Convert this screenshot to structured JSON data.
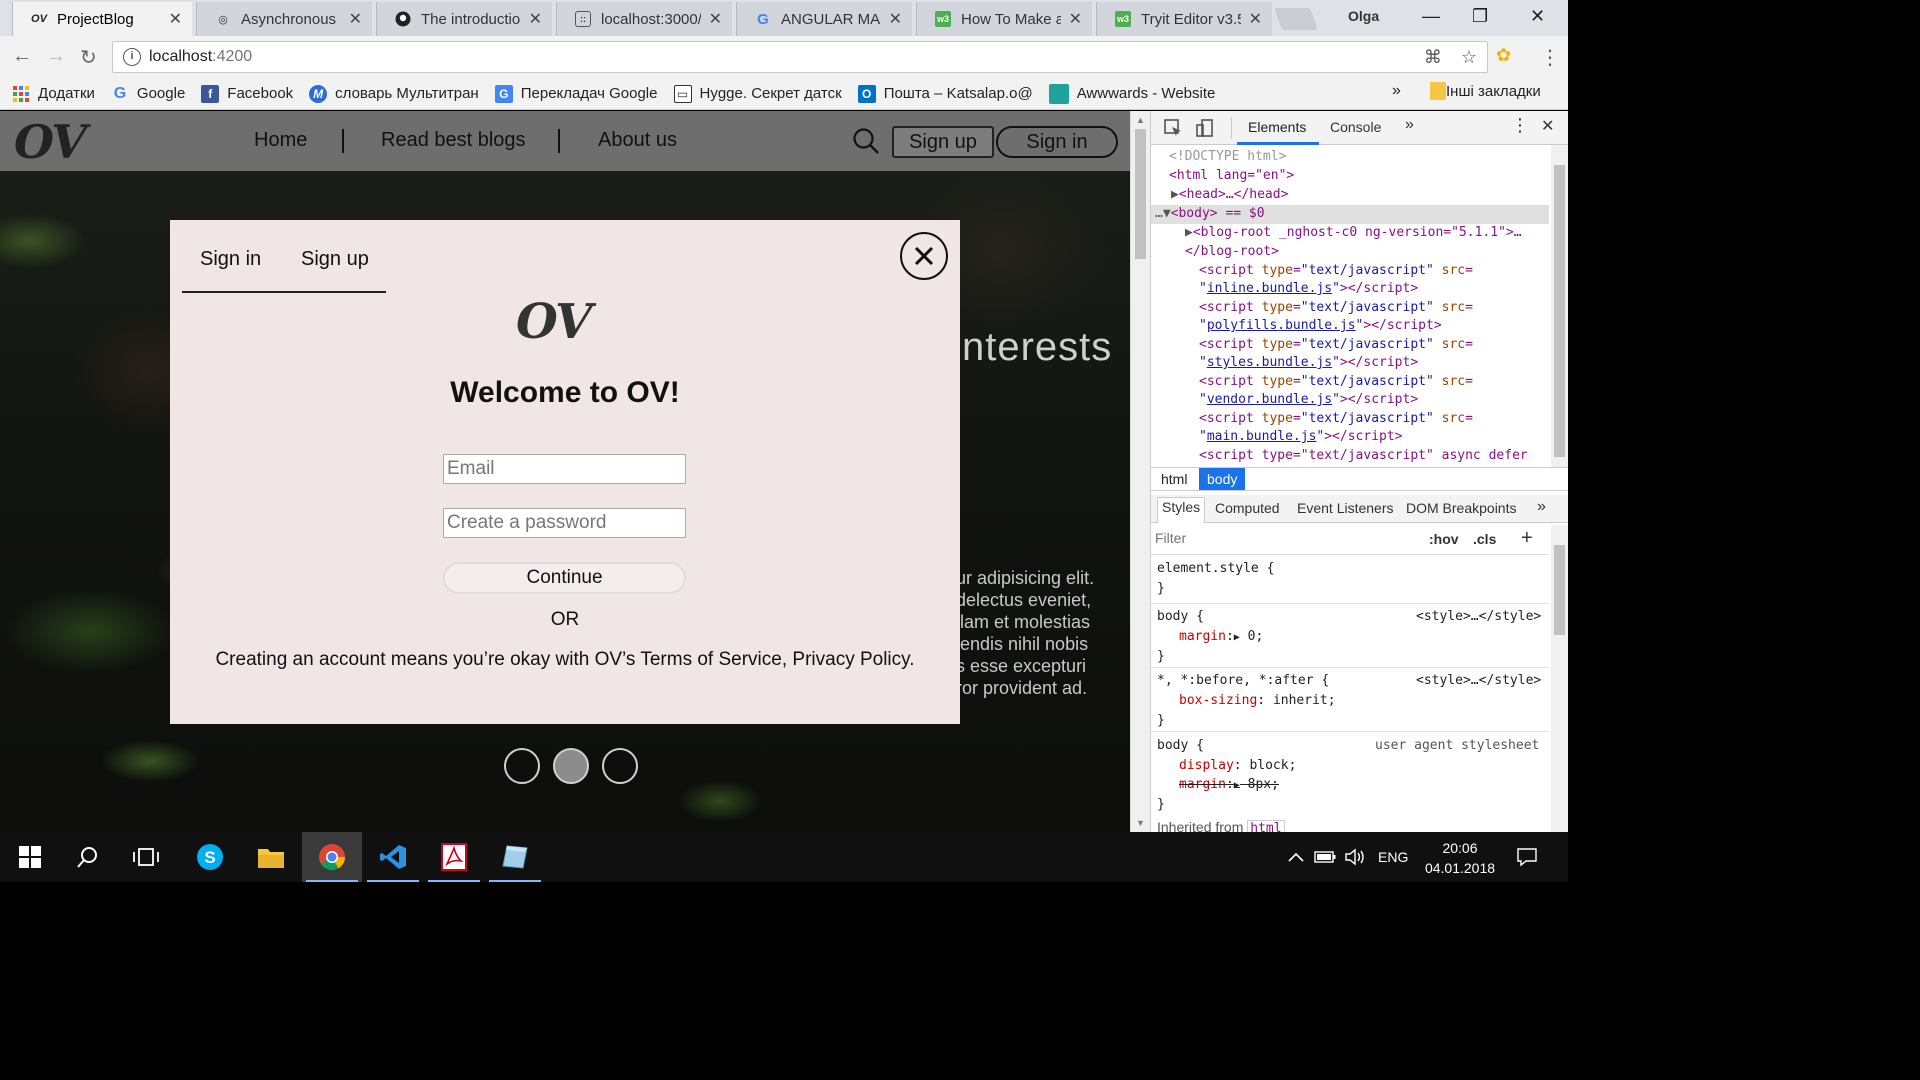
{
  "browser": {
    "tabs": [
      {
        "title": "ProjectBlog",
        "favicon": "OV",
        "active": true
      },
      {
        "title": "Asynchronous P",
        "favicon": "glasses-icon",
        "active": false
      },
      {
        "title": "The introductio",
        "favicon": "github-icon",
        "active": false
      },
      {
        "title": "localhost:3000/",
        "favicon": "page-icon",
        "active": false
      },
      {
        "title": "ANGULAR MAK",
        "favicon": "google-icon",
        "active": false
      },
      {
        "title": "How To Make a",
        "favicon": "w3-icon",
        "active": false
      },
      {
        "title": "Tryit Editor v3.5",
        "favicon": "w3-icon",
        "active": false
      }
    ],
    "profile_name": "Olga",
    "address": {
      "host": "localhost",
      "port": ":4200"
    },
    "bookmarks": [
      {
        "label": "Додатки",
        "icon": "apps-icon",
        "color": "#e94235"
      },
      {
        "label": "Google",
        "icon": "google-icon",
        "color": "#4285f4"
      },
      {
        "label": "Facebook",
        "icon": "facebook-icon",
        "color": "#3b5998"
      },
      {
        "label": "словарь Мультитран",
        "icon": "multitran-icon",
        "color": "#2a6fd6"
      },
      {
        "label": "Перекладач Google",
        "icon": "translate-icon",
        "color": "#4285f4"
      },
      {
        "label": "Hygge. Секрет датск",
        "icon": "book-icon",
        "color": "#333333"
      },
      {
        "label": "Пошта – Katsalap.o@",
        "icon": "outlook-icon",
        "color": "#0072c6"
      },
      {
        "label": "Awwwards - Website",
        "icon": "awwwards-icon",
        "color": "#1ba39c"
      }
    ],
    "bookmarks_more": "»",
    "other_bookmarks": "Інші закладки"
  },
  "site": {
    "logo": "OV",
    "nav": [
      "Home",
      "Read best blogs",
      "About us"
    ],
    "signup_label": "Sign up",
    "signin_label": "Sign in",
    "hero_title": "nterests",
    "hero_text": [
      "ur adipisicing elit.",
      "delectus eveniet,",
      "llam et molestias",
      "iendis nihil nobis",
      "s esse excepturi",
      "ror provident ad."
    ],
    "carousel": {
      "count": 3,
      "active_index": 1
    }
  },
  "modal": {
    "tab_signin": "Sign in",
    "tab_signup": "Sign up",
    "logo": "OV",
    "title": "Welcome to OV!",
    "email_placeholder": "Email",
    "password_placeholder": "Create a password",
    "continue_label": "Continue",
    "or_label": "OR",
    "terms": "Creating an account means you’re okay with OV’s Terms of Service, Privacy Policy."
  },
  "devtools": {
    "tabs": [
      "Elements",
      "Console"
    ],
    "more": "»",
    "dom": {
      "doctype": "<!DOCTYPE html>",
      "html_open": "<html lang=\"en\">",
      "head": "<head>…</head>",
      "body": "<body> == $0",
      "blog_root": "<blog-root _nghost-c0 ng-version=\"5.1.1\">…",
      "blog_root_close": "</blog-root>",
      "scripts": [
        "inline.bundle.js",
        "polyfills.bundle.js",
        "styles.bundle.js",
        "vendor.bundle.js",
        "main.bundle.js"
      ],
      "last_script": "<script type=\"text/javascript\" async defer"
    },
    "breadcrumbs": [
      "html",
      "body"
    ],
    "styles_tabs": [
      "Styles",
      "Computed",
      "Event Listeners",
      "DOM Breakpoints"
    ],
    "filter_placeholder": "Filter",
    "hov": ":hov",
    "cls": ".cls",
    "rules": {
      "element_style": "element.style {",
      "body1_selector": "body {",
      "body1_source": "<style>…</style>",
      "body1_prop": "margin",
      "body1_val": "0;",
      "universal_selector": "*, *:before, *:after {",
      "universal_source": "<style>…</style>",
      "universal_prop": "box-sizing",
      "universal_val": "inherit;",
      "body2_selector": "body {",
      "body2_source": "user agent stylesheet",
      "body2_prop1": "display",
      "body2_val1": "block;",
      "body2_prop2": "margin",
      "body2_val2": "8px;",
      "inherited_label": "Inherited from",
      "inherited_tag": "html"
    }
  },
  "taskbar": {
    "language": "ENG",
    "time": "20:06",
    "date": "04.01.2018"
  }
}
